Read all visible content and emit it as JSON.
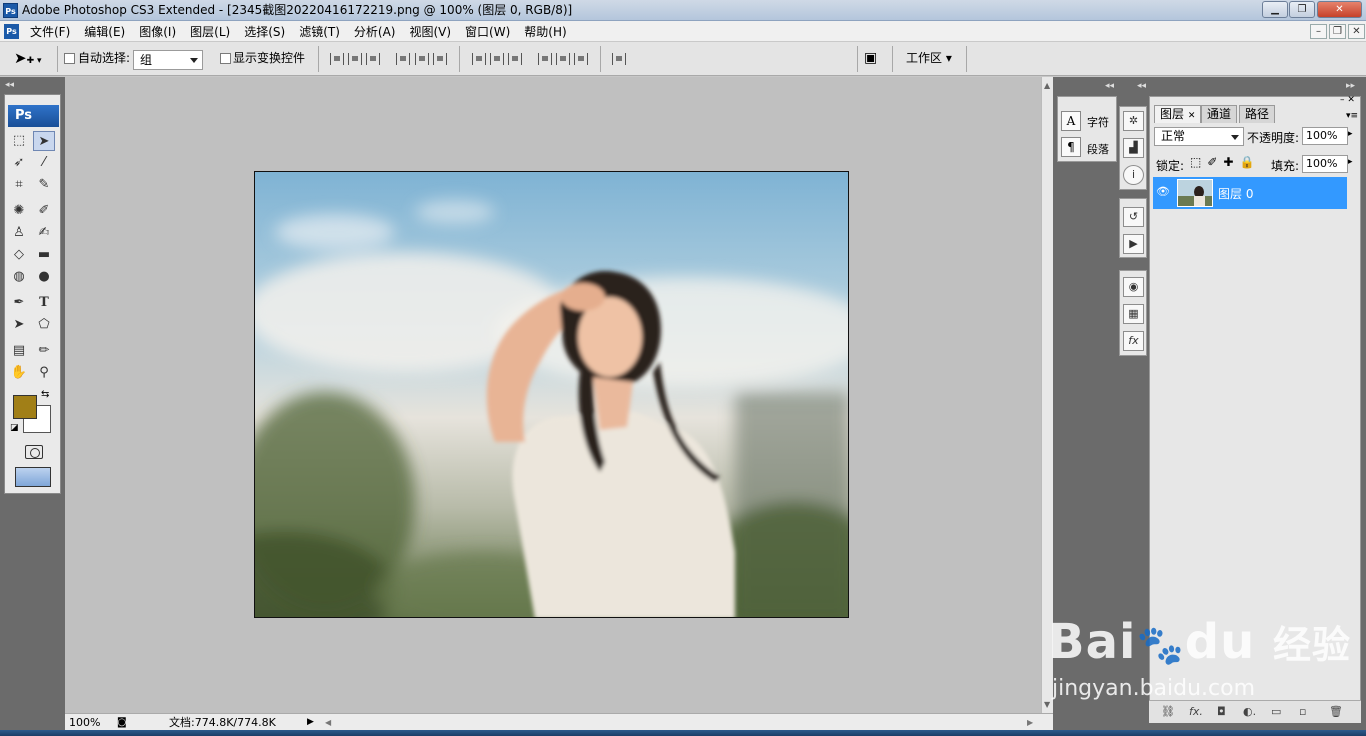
{
  "window": {
    "title": "Adobe Photoshop CS3 Extended - [2345截图20220416172219.png @ 100% (图层 0, RGB/8)]",
    "app_icon": "Ps"
  },
  "menu": [
    "文件(F)",
    "编辑(E)",
    "图像(I)",
    "图层(L)",
    "选择(S)",
    "滤镜(T)",
    "分析(A)",
    "视图(V)",
    "窗口(W)",
    "帮助(H)"
  ],
  "options": {
    "auto_select_label": "自动选择:",
    "auto_select_value": "组",
    "show_transform_label": "显示变换控件",
    "workspace_label": "工作区"
  },
  "toolbox": {
    "logo": "Ps",
    "tools": [
      "marquee",
      "move",
      "lasso",
      "magic-wand",
      "crop",
      "slice",
      "healing",
      "brush",
      "stamp",
      "history-brush",
      "eraser",
      "gradient",
      "blur",
      "dodge",
      "pen",
      "type",
      "path-select",
      "shape",
      "notes",
      "eyedropper",
      "hand",
      "zoom"
    ],
    "type_tool_glyph": "T",
    "foreground_color": "#a17f17",
    "background_color": "#ffffff"
  },
  "status": {
    "zoom": "100%",
    "doc_size": "文档:774.8K/774.8K"
  },
  "char_panel": {
    "char_label": "字符",
    "para_label": "段落",
    "char_icon": "A",
    "para_icon": "¶"
  },
  "layers_panel": {
    "tabs": [
      "图层",
      "通道",
      "路径"
    ],
    "blend_mode": "正常",
    "opacity_label": "不透明度:",
    "opacity_value": "100%",
    "lock_label": "锁定:",
    "fill_label": "填充:",
    "fill_value": "100%",
    "layers": [
      {
        "name": "图层 0",
        "visible": true,
        "selected": true
      }
    ],
    "selected_color": "#3399ff"
  },
  "watermark": {
    "brand_left": "Bai",
    "brand_right": "du",
    "brand_cn": "经验",
    "url": "jingyan.baidu.com"
  }
}
